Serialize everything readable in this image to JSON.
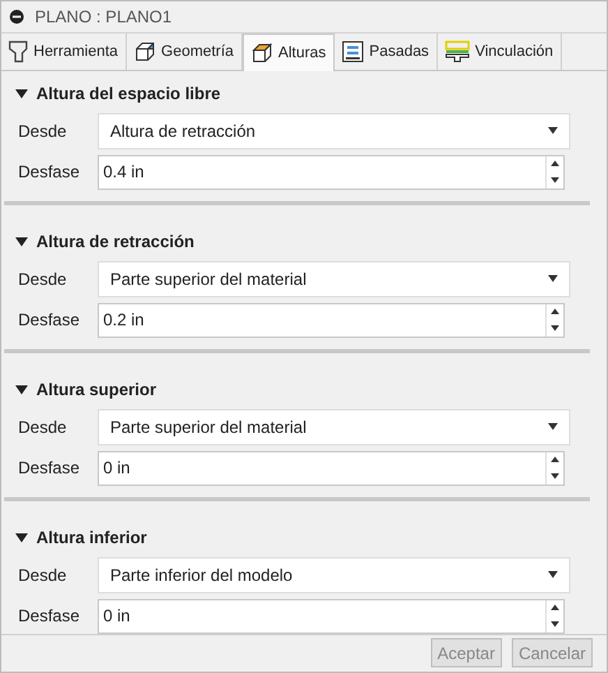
{
  "window": {
    "title": "PLANO : PLANO1"
  },
  "tabs": [
    {
      "label": "Herramienta",
      "selected": false
    },
    {
      "label": "Geometría",
      "selected": false
    },
    {
      "label": "Alturas",
      "selected": true
    },
    {
      "label": "Pasadas",
      "selected": false
    },
    {
      "label": "Vinculación",
      "selected": false
    }
  ],
  "sections": [
    {
      "title": "Altura del espacio libre",
      "expanded": true,
      "from_label": "Desde",
      "from_value": "Altura de retracción",
      "offset_label": "Desfase",
      "offset_value": "0.4 in"
    },
    {
      "title": "Altura de retracción",
      "expanded": true,
      "from_label": "Desde",
      "from_value": "Parte superior del material",
      "offset_label": "Desfase",
      "offset_value": "0.2 in"
    },
    {
      "title": "Altura superior",
      "expanded": true,
      "from_label": "Desde",
      "from_value": "Parte superior del material",
      "offset_label": "Desfase",
      "offset_value": "0 in"
    },
    {
      "title": "Altura inferior",
      "expanded": true,
      "from_label": "Desde",
      "from_value": "Parte inferior del modelo",
      "offset_label": "Desfase",
      "offset_value": "0 in"
    }
  ],
  "buttons": [
    {
      "label": "Aceptar",
      "disabled": true
    },
    {
      "label": "Cancelar",
      "disabled": true
    }
  ]
}
